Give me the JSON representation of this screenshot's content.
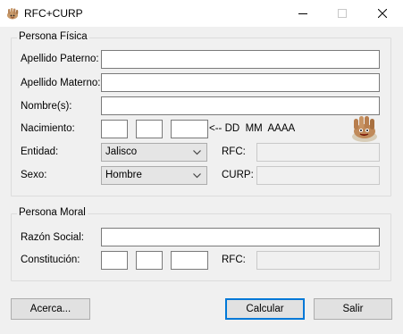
{
  "window": {
    "title": "RFC+CURP",
    "icon": "app-hand-icon"
  },
  "persona_fisica": {
    "legend": "Persona Física",
    "apellido_paterno_label": "Apellido Paterno:",
    "apellido_paterno_value": "",
    "apellido_materno_label": "Apellido Materno:",
    "apellido_materno_value": "",
    "nombres_label": "Nombre(s):",
    "nombres_value": "",
    "nacimiento_label": "Nacimiento:",
    "nacimiento_day": "",
    "nacimiento_month": "",
    "nacimiento_year": "",
    "date_hint": "<-- DD  MM  AAAA",
    "entidad_label": "Entidad:",
    "entidad_value": "Jalisco",
    "sexo_label": "Sexo:",
    "sexo_value": "Hombre",
    "rfc_label": "RFC:",
    "rfc_value": "",
    "curp_label": "CURP:",
    "curp_value": ""
  },
  "persona_moral": {
    "legend": "Persona Moral",
    "razon_social_label": "Razón Social:",
    "razon_social_value": "",
    "constitucion_label": "Constitución:",
    "constitucion_day": "",
    "constitucion_month": "",
    "constitucion_year": "",
    "rfc_label": "RFC:",
    "rfc_value": ""
  },
  "buttons": {
    "acerca": "Acerca...",
    "calcular": "Calcular",
    "salir": "Salir"
  },
  "icons": {
    "minimize": "minimize-icon",
    "maximize": "maximize-icon",
    "close": "close-icon",
    "mascot": "hand-mascot-icon",
    "dropdown": "chevron-down-icon"
  }
}
